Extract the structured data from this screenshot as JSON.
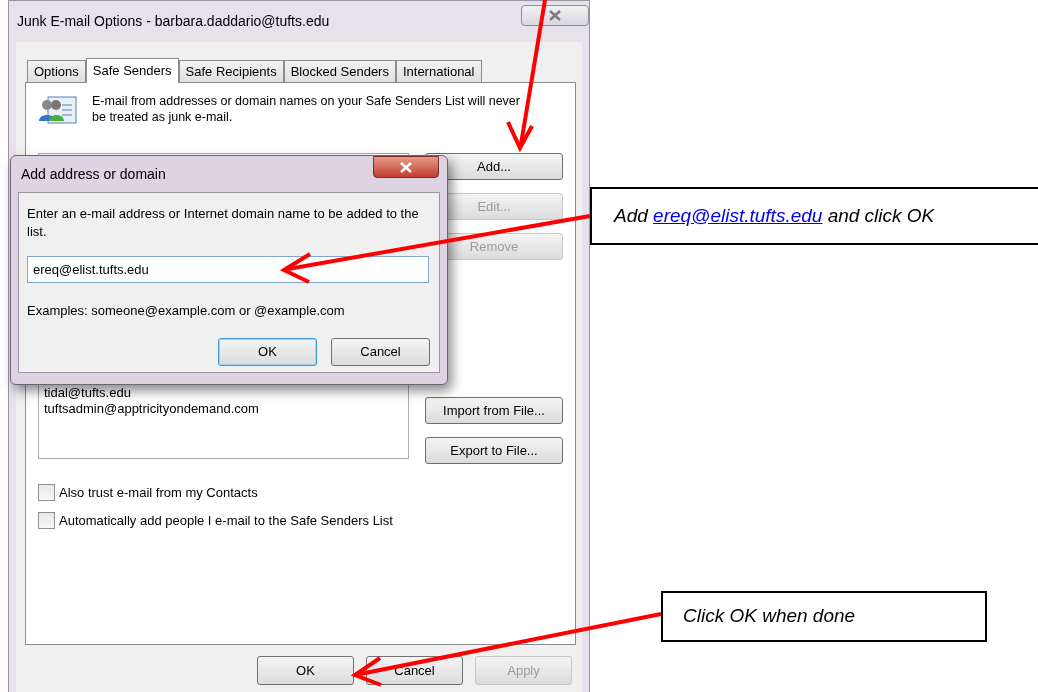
{
  "window": {
    "title": "Junk E-mail Options - barbara.daddario@tufts.edu"
  },
  "tabs": [
    {
      "label": "Options",
      "selected": false
    },
    {
      "label": "Safe Senders",
      "selected": true
    },
    {
      "label": "Safe Recipients",
      "selected": false
    },
    {
      "label": "Blocked Senders",
      "selected": false
    },
    {
      "label": "International",
      "selected": false
    }
  ],
  "description": "E-mail from addresses or domain names on your Safe Senders List will never be treated as junk e-mail.",
  "safe_senders": [
    "tidal@tufts.edu",
    "tuftsadmin@apptricityondemand.com"
  ],
  "side_buttons_top": [
    {
      "label": "Add...",
      "disabled": false
    },
    {
      "label": "Edit...",
      "disabled": true
    },
    {
      "label": "Remove",
      "disabled": true
    }
  ],
  "side_buttons_bottom": [
    {
      "label": "Import from File...",
      "disabled": false
    },
    {
      "label": "Export to File...",
      "disabled": false
    }
  ],
  "options": [
    {
      "label": "Also trust e-mail from my Contacts",
      "checked": false
    },
    {
      "label": "Automatically add people I e-mail to the Safe Senders List",
      "checked": false
    }
  ],
  "footer_buttons": [
    {
      "label": "OK",
      "disabled": false
    },
    {
      "label": "Cancel",
      "disabled": false
    },
    {
      "label": "Apply",
      "disabled": true
    }
  ],
  "add_dialog": {
    "title": "Add address or domain",
    "prompt": "Enter an e-mail address or Internet domain name to be added to the list.",
    "value": "ereq@elist.tufts.edu",
    "examples": "Examples: someone@example.com or @example.com",
    "buttons": [
      {
        "label": "OK",
        "default": true
      },
      {
        "label": "Cancel",
        "default": false
      }
    ]
  },
  "callouts": [
    {
      "before": "Add",
      "link": "ereq@elist.tufts.edu",
      "after": "and click OK"
    },
    {
      "before": "Click OK when done"
    }
  ]
}
